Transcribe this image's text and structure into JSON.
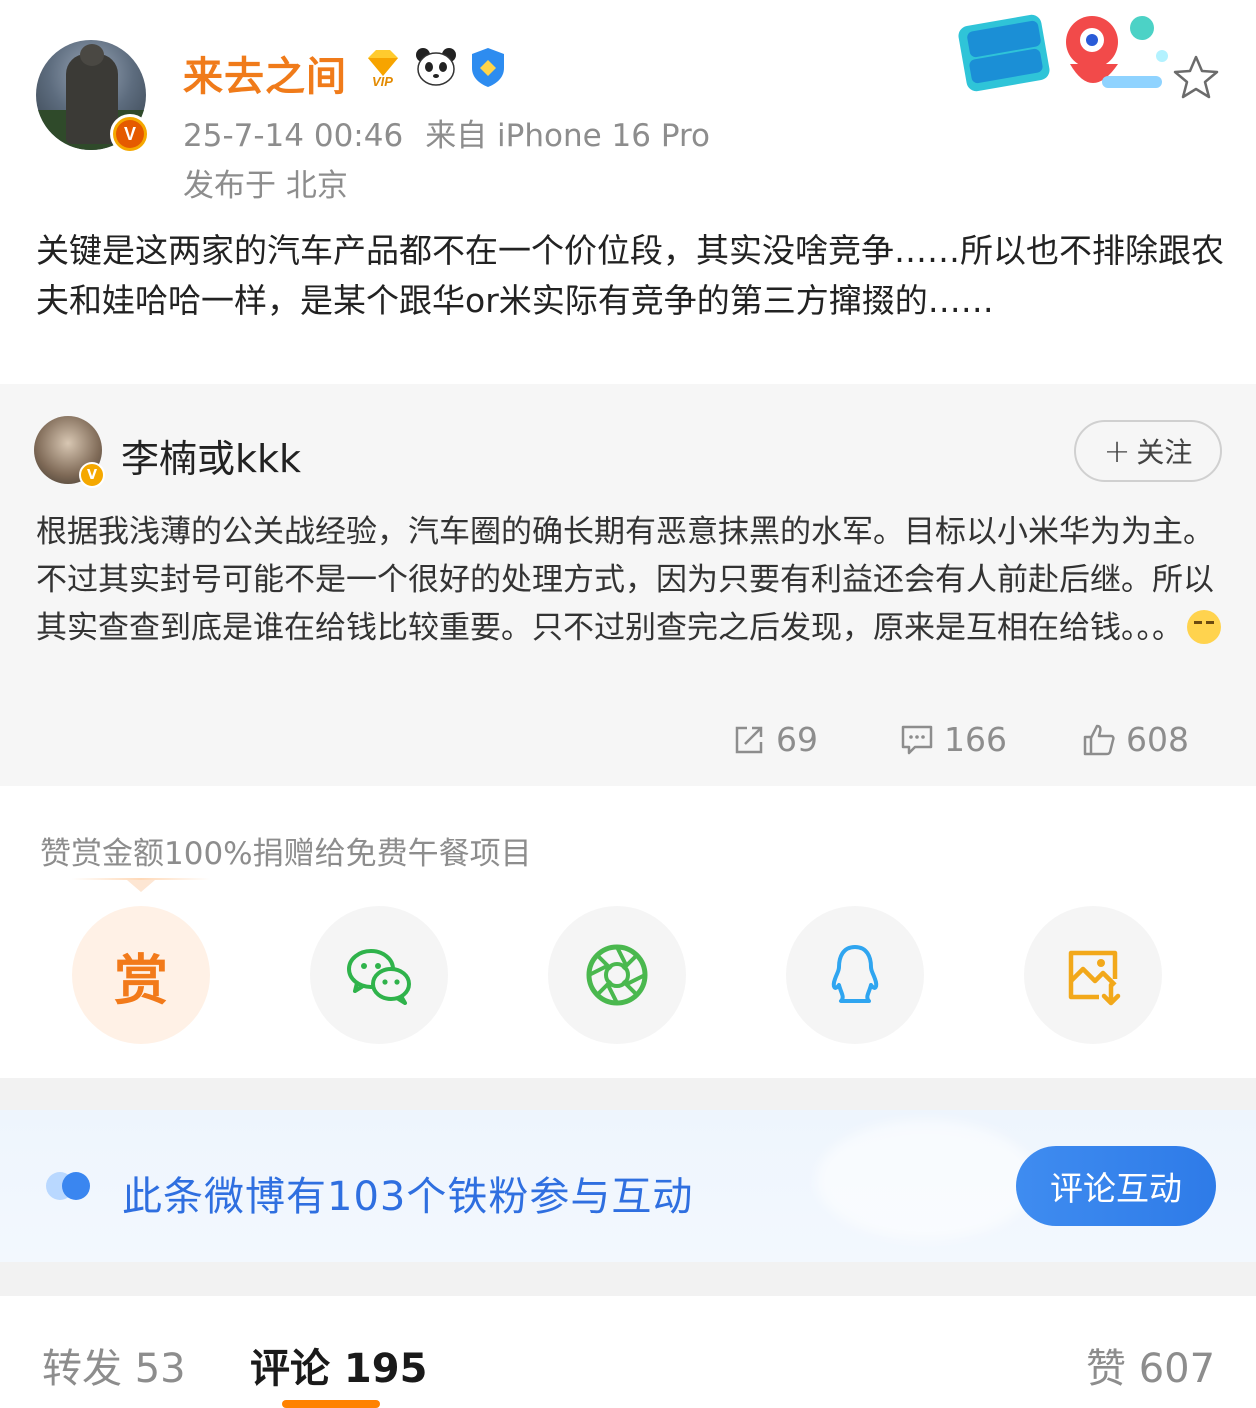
{
  "post": {
    "author": {
      "name": "来去之间"
    },
    "timestamp": "25-7-14 00:46",
    "source": "来自 iPhone 16 Pro",
    "location": "发布于 北京",
    "text": "关键是这两家的汽车产品都不在一个价位段，其实没啥竞争……所以也不排除跟农夫和娃哈哈一样，是某个跟华or米实际有竞争的第三方撺掇的……"
  },
  "repost": {
    "author_name": "李楠或kkk",
    "follow_label": "关注",
    "text": "根据我浅薄的公关战经验，汽车圈的确长期有恶意抹黑的水军。目标以小米华为为主。不过其实封号可能不是一个很好的处理方式，因为只要有利益还会有人前赴后继。所以其实查查到底是谁在给钱比较重要。只不过别查完之后发现，原来是互相在给钱。。。",
    "stats": {
      "reposts": "69",
      "comments": "166",
      "likes": "608"
    }
  },
  "reward": {
    "note": "赞赏金额100%捐赠给免费午餐项目",
    "reward_label": "赏"
  },
  "fans_banner": {
    "text": "此条微博有103个铁粉参与互动",
    "button": "评论互动"
  },
  "tabs": {
    "reposts": "转发 53",
    "comments": "评论 195",
    "likes": "赞 607"
  },
  "colors": {
    "username": "#f07b1a",
    "accent_blue": "#2f6fe0",
    "tab_underline": "#ff8200"
  }
}
